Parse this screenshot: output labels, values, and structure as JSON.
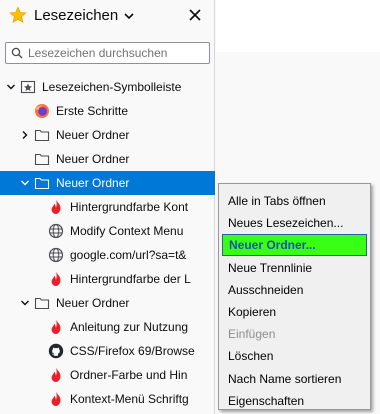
{
  "sidebar": {
    "title": "Lesezeichen",
    "search_placeholder": "Lesezeichen durchsuchen"
  },
  "tree": {
    "rows": [
      {
        "label": "Lesezeichen-Symbolleiste",
        "icon": "toolbar-icon",
        "twisty": "expanded",
        "depth": 0
      },
      {
        "label": "Erste Schritte",
        "icon": "firefox-icon",
        "twisty": "none",
        "depth": 1
      },
      {
        "label": "Neuer Ordner",
        "icon": "folder-icon",
        "twisty": "collapsed",
        "depth": 1
      },
      {
        "label": "Neuer Ordner",
        "icon": "folder-icon",
        "twisty": "none",
        "depth": 1
      },
      {
        "label": "Neuer Ordner",
        "icon": "folder-icon",
        "twisty": "expanded",
        "depth": 1,
        "selected": true
      },
      {
        "label": "Hintergrundfarbe Kont",
        "icon": "flame-icon",
        "twisty": "none",
        "depth": 2
      },
      {
        "label": "Modify Context Menu",
        "icon": "globe-icon",
        "twisty": "none",
        "depth": 2
      },
      {
        "label": "google.com/url?sa=t&",
        "icon": "globe-icon",
        "twisty": "none",
        "depth": 2
      },
      {
        "label": "Hintergrundfarbe der L",
        "icon": "flame-icon",
        "twisty": "none",
        "depth": 2
      },
      {
        "label": "Neuer Ordner",
        "icon": "folder-icon",
        "twisty": "expanded",
        "depth": 1
      },
      {
        "label": "Anleitung zur Nutzung",
        "icon": "flame-icon",
        "twisty": "none",
        "depth": 2
      },
      {
        "label": "CSS/Firefox 69/Browse",
        "icon": "github-icon",
        "twisty": "none",
        "depth": 2
      },
      {
        "label": "Ordner-Farbe und Hin",
        "icon": "flame-icon",
        "twisty": "none",
        "depth": 2
      },
      {
        "label": "Kontext-Menü Schriftg",
        "icon": "flame-icon",
        "twisty": "none",
        "depth": 2
      }
    ]
  },
  "context_menu": {
    "items": [
      {
        "label": "Alle in Tabs öffnen",
        "state": "normal"
      },
      {
        "label": "Neues Lesezeichen...",
        "state": "normal"
      },
      {
        "label": "Neuer Ordner...",
        "state": "highlighted"
      },
      {
        "label": "Neue Trennlinie",
        "state": "normal"
      },
      {
        "label": "Ausschneiden",
        "state": "normal"
      },
      {
        "label": "Kopieren",
        "state": "normal"
      },
      {
        "label": "Einfügen",
        "state": "disabled"
      },
      {
        "label": "Löschen",
        "state": "normal"
      },
      {
        "label": "Nach Name sortieren",
        "state": "normal"
      },
      {
        "label": "Eigenschaften",
        "state": "normal"
      }
    ]
  },
  "colors": {
    "selection": "#0078d7",
    "menu_highlight": "#39ff14",
    "flame": "#e8202a",
    "star": "#ffbf00"
  }
}
